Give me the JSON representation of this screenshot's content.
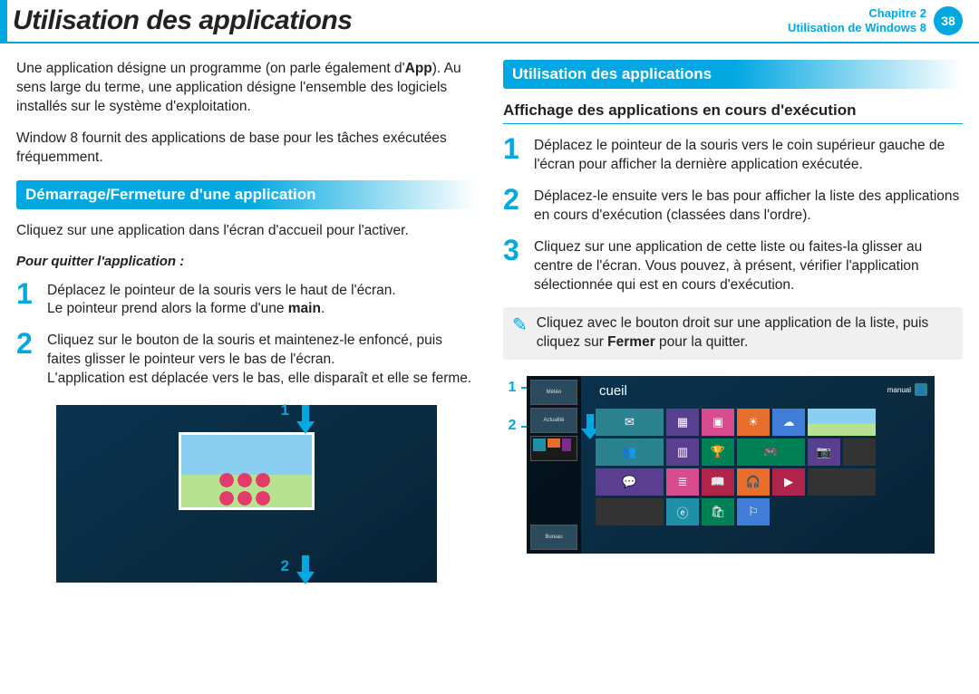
{
  "header": {
    "title": "Utilisation des applications",
    "chapter_line1": "Chapitre 2",
    "chapter_line2": "Utilisation de Windows 8",
    "page_number": "38"
  },
  "left": {
    "intro1_prefix": "Une application désigne un programme (on parle également d'",
    "intro1_bold": "App",
    "intro1_suffix": "). Au sens large du terme, une application désigne l'ensemble des logiciels installés sur le système d'exploitation.",
    "intro2": "Window 8 fournit des applications de base pour les tâches exécutées fréquemment.",
    "heading1": "Démarrage/Fermeture d'une application",
    "click_text": "Cliquez sur une application dans l'écran d'accueil pour l'activer.",
    "quit_heading": "Pour quitter l'application :",
    "step1_line1": " Déplacez le pointeur de la souris vers le haut de l'écran.",
    "step1_line2_prefix": "Le pointeur prend alors la forme d'une ",
    "step1_line2_bold": "main",
    "step1_line2_suffix": ".",
    "step2_line1": "Cliquez sur le bouton de la souris et maintenez-le enfoncé, puis faites glisser le pointeur vers le bas de l'écran.",
    "step2_line2": "L'application est déplacée vers le bas, elle disparaît et elle se ferme.",
    "callout1": "1",
    "callout2": "2"
  },
  "right": {
    "heading1": "Utilisation des applications",
    "heading2": "Affichage des applications en cours d'exécution",
    "step1": "Déplacez le pointeur de la souris vers le coin supérieur gauche de l'écran pour afficher la dernière application exécutée.",
    "step2": "Déplacez-le ensuite vers le bas pour afficher la liste des applications en cours d'exécution (classées dans l'ordre).",
    "step3": "Cliquez sur une application de cette liste ou faites-la glisser au centre de l'écran. Vous pouvez, à présent, vérifier l'application sélectionnée qui est en cours d'exécution.",
    "note_prefix": "Cliquez avec le bouton droit sur une application de la liste, puis cliquez sur ",
    "note_bold": "Fermer",
    "note_suffix": " pour la quitter.",
    "callout1": "1",
    "callout2": "2",
    "shot": {
      "start_suffix": "cueil",
      "username": "manual",
      "thumbs": {
        "t1": "Météo",
        "t2": "Actualité",
        "t3": "Bureau"
      }
    }
  },
  "nums": {
    "n1": "1",
    "n2": "2",
    "n3": "3"
  }
}
